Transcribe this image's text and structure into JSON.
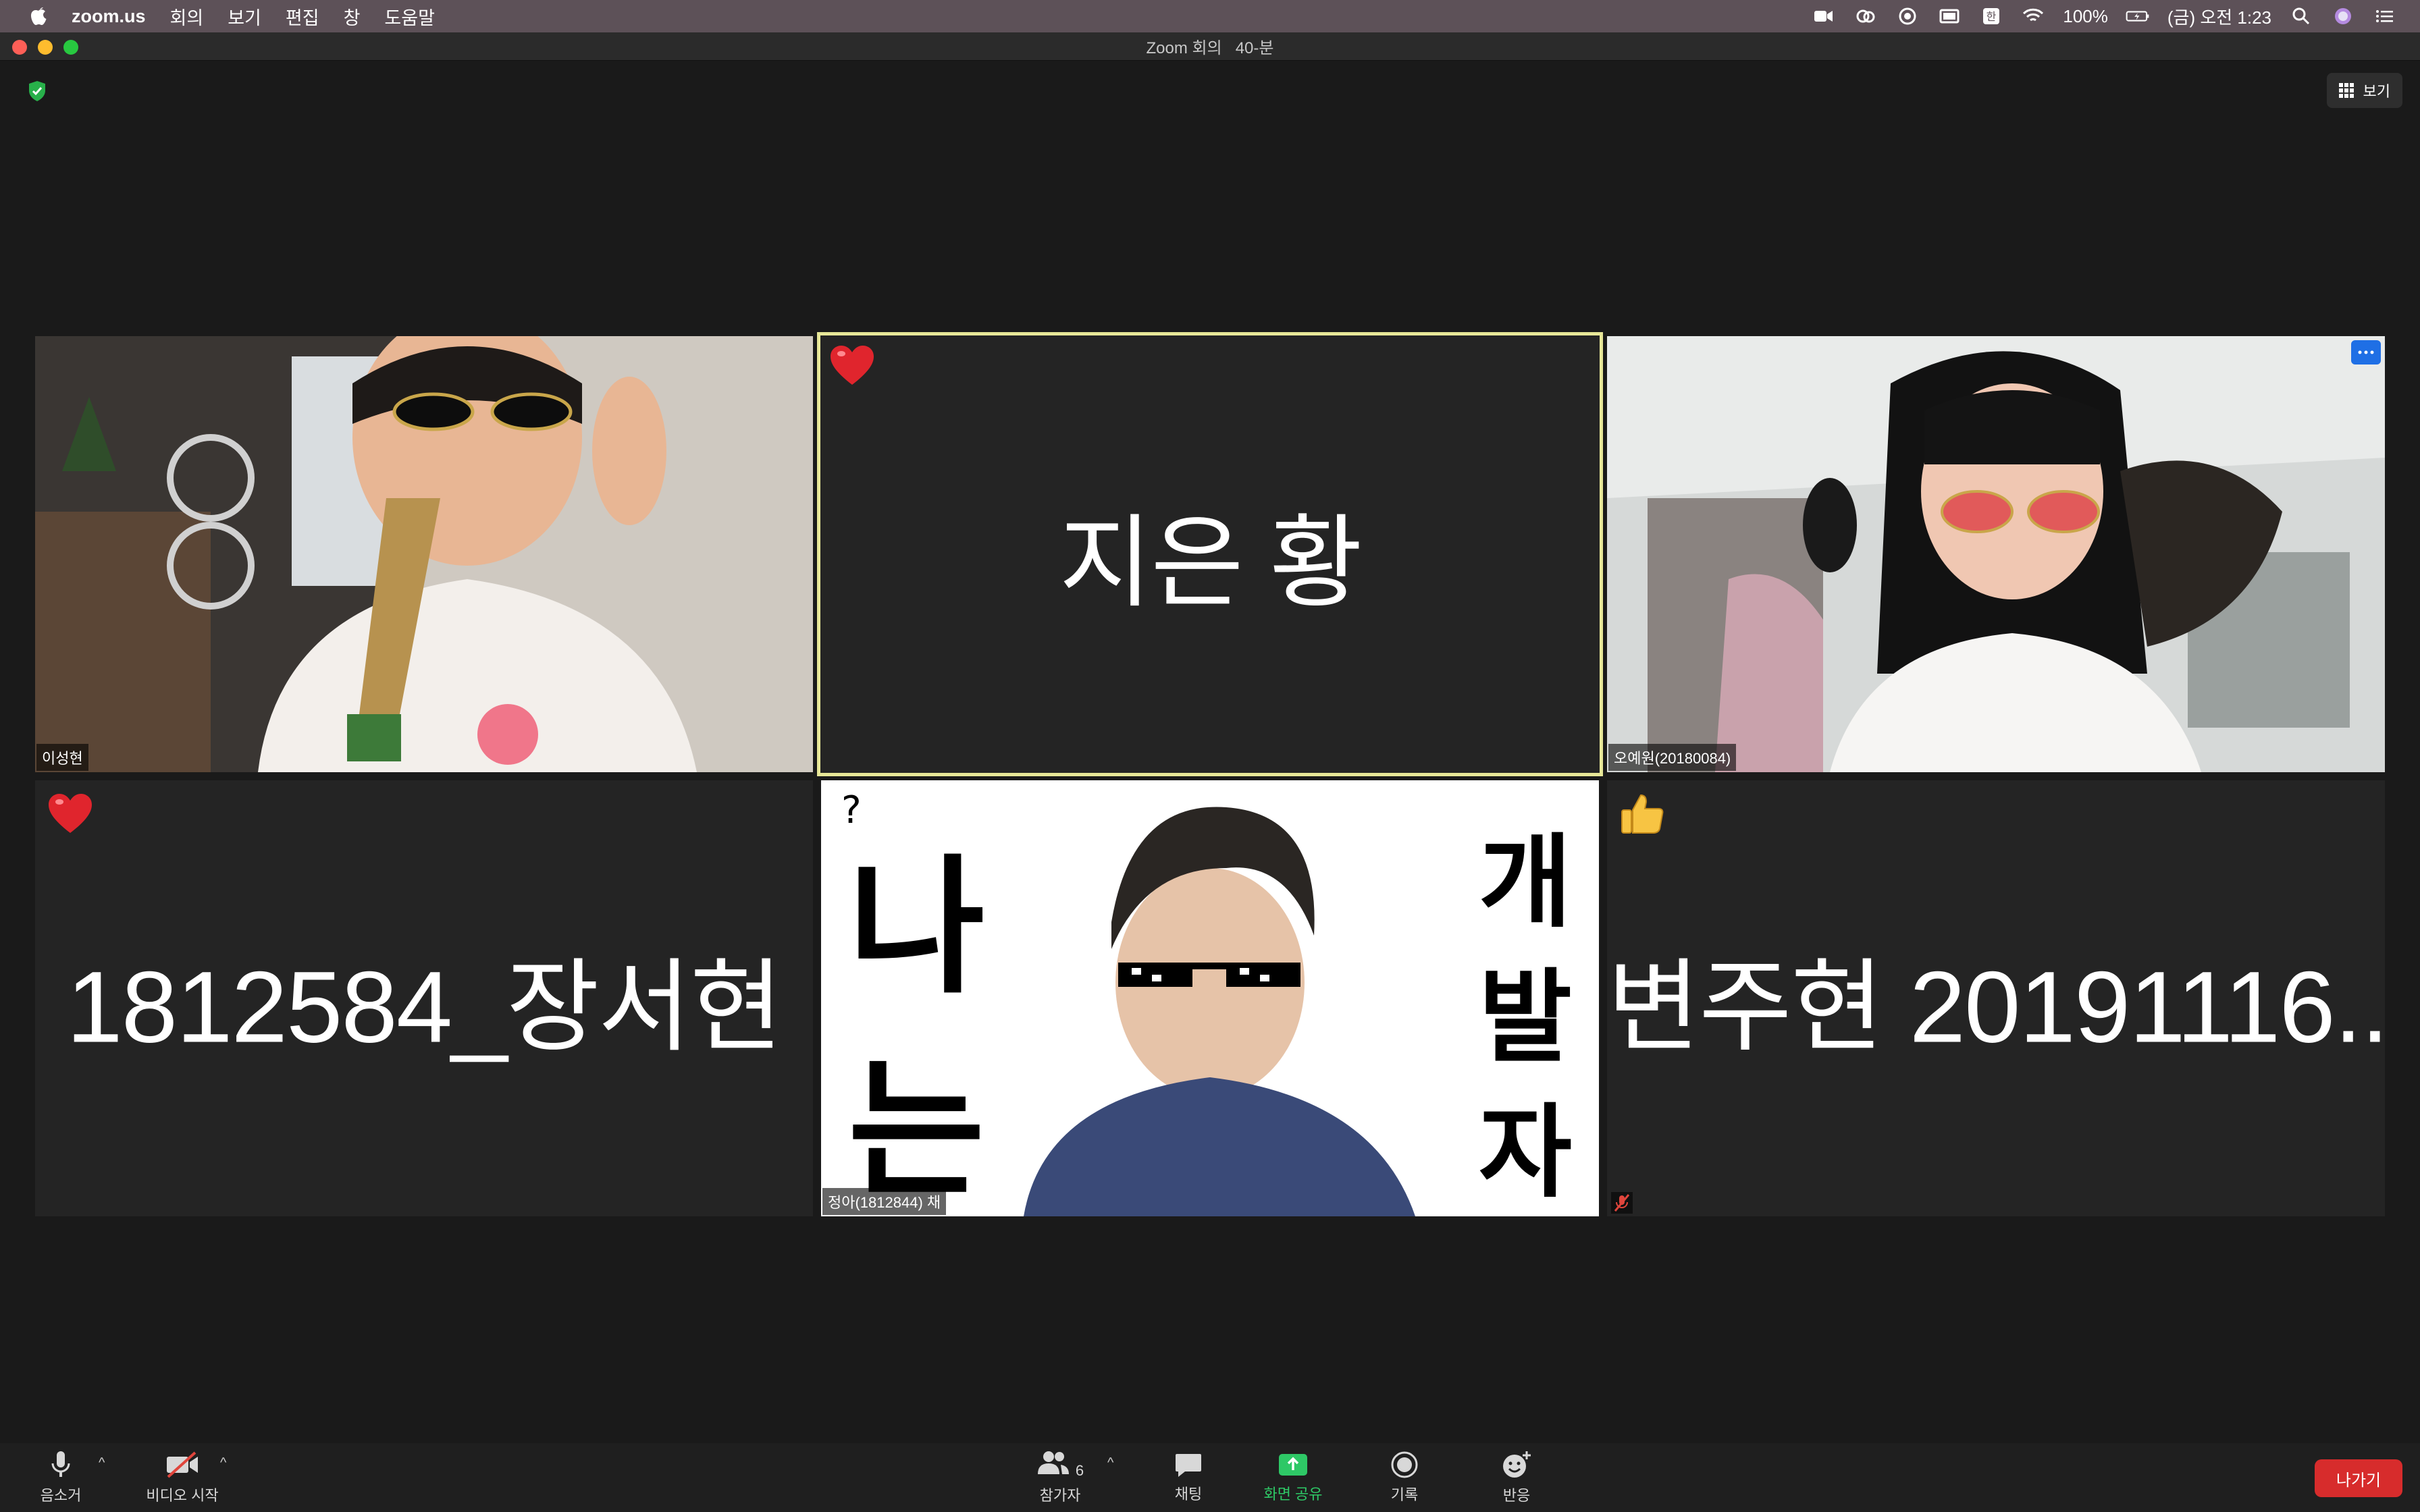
{
  "menubar": {
    "app_name": "zoom.us",
    "menus": [
      "회의",
      "보기",
      "편집",
      "창",
      "도움말"
    ],
    "battery": "100%",
    "clock": "(금) 오전 1:23"
  },
  "window": {
    "title": "Zoom 회의   40-분"
  },
  "view_button": {
    "label": "보기"
  },
  "participants": [
    {
      "name": "이성현",
      "video": true,
      "reaction": ""
    },
    {
      "display": "지은 황",
      "video": false,
      "reaction": "heart",
      "speaking": true
    },
    {
      "name": "오예원(20180084)",
      "video": true,
      "reaction": ""
    },
    {
      "display": "1812584_장서현",
      "video": false,
      "reaction": "heart"
    },
    {
      "name": "정아(1812844) 채",
      "video": true,
      "reaction": "",
      "background_text": {
        "question": "?",
        "left": [
          "나",
          "는"
        ],
        "right": [
          "개",
          "발",
          "자"
        ]
      }
    },
    {
      "display": "변주현 20191116...",
      "video": false,
      "reaction": "thumbs-up",
      "muted": true
    }
  ],
  "toolbar": {
    "mute": "음소거",
    "video": "비디오 시작",
    "participants": "참가자",
    "participants_count": "6",
    "chat": "채팅",
    "share": "화면 공유",
    "record": "기록",
    "reactions": "반응",
    "leave": "나가기"
  },
  "colors": {
    "share_accent": "#2ec866",
    "leave_red": "#d72c2c",
    "active_speaker": "#e7e798"
  }
}
